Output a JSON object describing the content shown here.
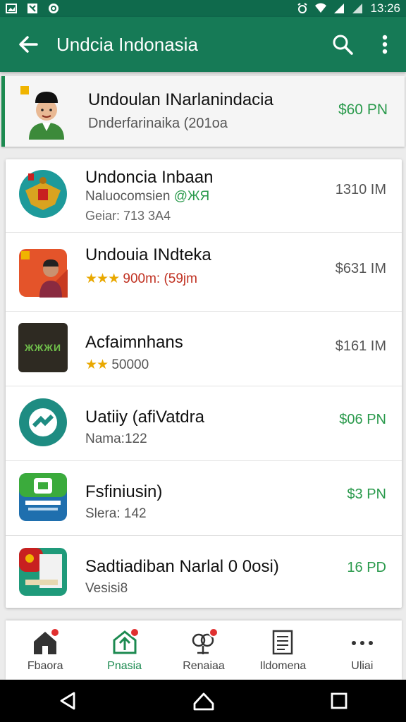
{
  "status_bar": {
    "time": "13:26"
  },
  "app_bar": {
    "title": "Undcia Indonasia"
  },
  "featured": {
    "title": "Undoulan INarlanindacia",
    "subtitle": "Dnderfarinaika (201oa",
    "price": "$60 PN"
  },
  "items": [
    {
      "name": "Undoncia Inbaan",
      "line1": "Naluocomsien",
      "line1_tag": "@ЖЯ",
      "line2": "Geiar: 713 3A4",
      "price": "1310 IM"
    },
    {
      "name": "Undouia INdteka",
      "stars": "★★★",
      "line1": "900m: (59jm",
      "price": "$631 IM"
    },
    {
      "name": "Acfaimnhans",
      "stars": "★★",
      "line1": "50000",
      "price": "$161 IM",
      "icon_text": "ЖЖЖИ"
    },
    {
      "name": "Uatiiy (afiVatdra",
      "line1": "Nama:122",
      "price": "$06 PN"
    },
    {
      "name": "Fsfiniusin)",
      "line1": "Slera: 142",
      "price": "$3 PN"
    },
    {
      "name": "Sadtiadiban Narlal 0 0osi)",
      "line1": "Vesisi8",
      "price": "16 PD"
    }
  ],
  "bottom_nav": [
    {
      "label": "Fbaora"
    },
    {
      "label": "Pnasia"
    },
    {
      "label": "Renaiaa"
    },
    {
      "label": "Ildomena"
    },
    {
      "label": "Uliai"
    }
  ],
  "colors": {
    "primary": "#167a56",
    "accent": "#1c8a50",
    "price_green": "#2a9a4c",
    "star": "#e9a800"
  }
}
